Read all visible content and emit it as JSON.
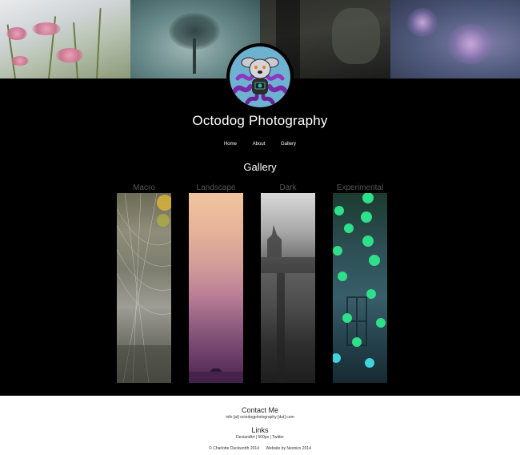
{
  "site": {
    "title": "Octodog Photography"
  },
  "nav": {
    "items": [
      {
        "label": "Home"
      },
      {
        "label": "About"
      },
      {
        "label": "Gallery"
      }
    ]
  },
  "main": {
    "heading": "Gallery",
    "categories": [
      {
        "label": "Macro"
      },
      {
        "label": "Landscape"
      },
      {
        "label": "Dark"
      },
      {
        "label": "Experimental"
      }
    ]
  },
  "footer": {
    "contact_heading": "Contact Me",
    "contact_email": "info [at] octodogphotography [dot] com",
    "links_heading": "Links",
    "links": [
      {
        "label": "DeviantArt"
      },
      {
        "label": "500px"
      },
      {
        "label": "Twitter"
      }
    ],
    "link_separator": " | ",
    "copyright": "© Charlotte Duckworth 2014",
    "credit": "Website by Neonics 2014"
  },
  "colors": {
    "background": "#000000",
    "footer_background": "#ffffff",
    "category_label": "#555555",
    "logo_circle": "#6fb1d0"
  }
}
